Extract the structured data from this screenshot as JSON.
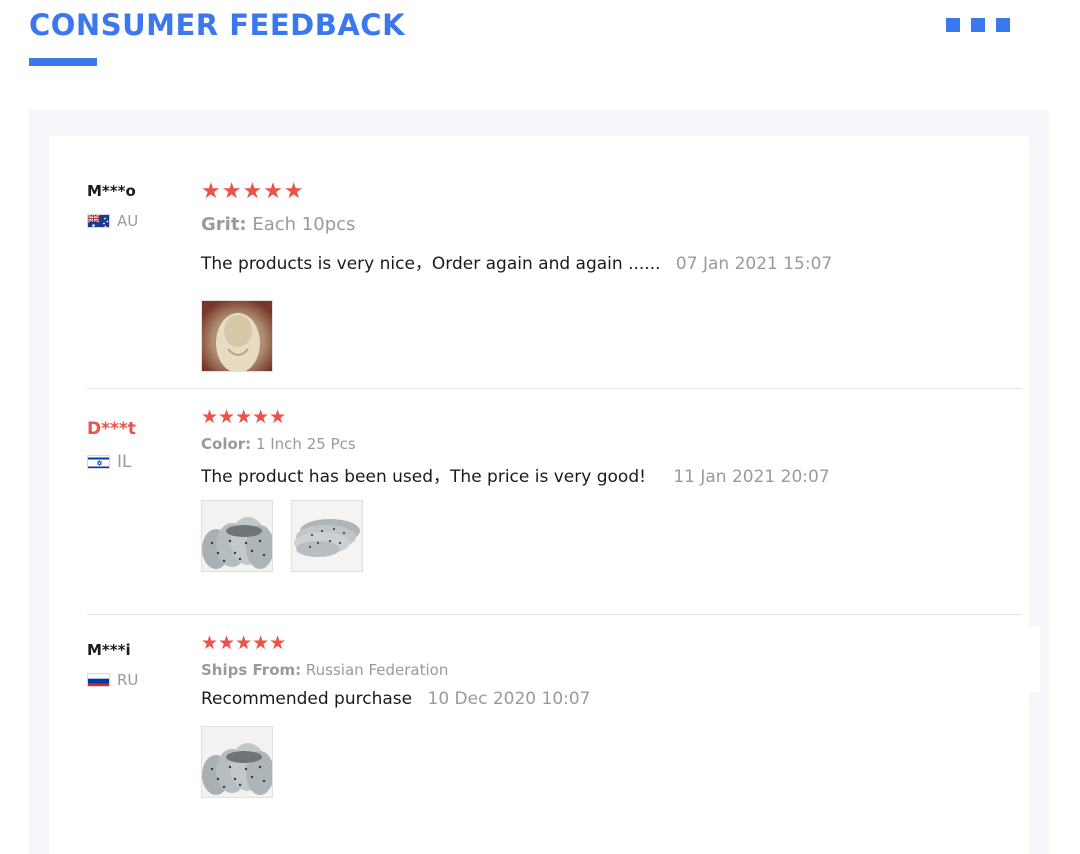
{
  "header": {
    "title": "CONSUMER FEEDBACK"
  },
  "colors": {
    "accent": "#3b78ee",
    "stars": "#e8534a",
    "muted_text": "#9a9a9a",
    "panel_bg": "#f5f6fa"
  },
  "reviews": [
    {
      "user": "M***o",
      "country": "AU",
      "flag_icon": "australia-flag-icon",
      "rating": 5,
      "stars": "★★★★★",
      "sku_label": "Grit:",
      "sku_value": "Each 10pcs",
      "comment": "The products is very nice，Order again and again ......",
      "date": "07 Jan 2021 15:07",
      "photos": [
        "photo-1"
      ]
    },
    {
      "user": "D***t",
      "country": "IL",
      "flag_icon": "israel-flag-icon",
      "rating": 5,
      "stars": "★★★★★",
      "sku_label": "Color:",
      "sku_value": "1 Inch 25 Pcs",
      "comment": "The product has been used，The price is very good!",
      "date": "11 Jan 2021 20:07",
      "photos": [
        "photo-1",
        "photo-2"
      ]
    },
    {
      "user": "M***i",
      "country": "RU",
      "flag_icon": "russia-flag-icon",
      "rating": 5,
      "stars": "★★★★★",
      "sku_label": "Ships From:",
      "sku_value": "Russian Federation",
      "comment": "Recommended purchase",
      "date": "10 Dec 2020 10:07",
      "photos": [
        "photo-1"
      ]
    }
  ]
}
